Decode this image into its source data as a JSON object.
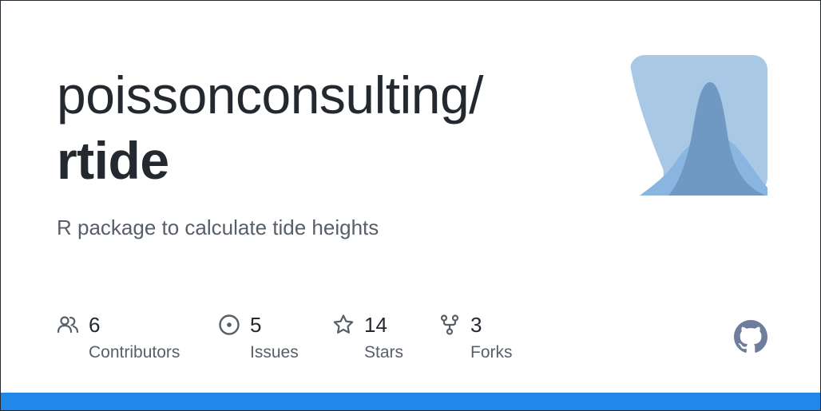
{
  "repo": {
    "owner": "poissonconsulting/",
    "name": "rtide",
    "description": "R package to calculate tide heights"
  },
  "stats": [
    {
      "icon": "people-icon",
      "count": "6",
      "label": "Contributors"
    },
    {
      "icon": "issue-icon",
      "count": "5",
      "label": "Issues"
    },
    {
      "icon": "star-icon",
      "count": "14",
      "label": "Stars"
    },
    {
      "icon": "fork-icon",
      "count": "3",
      "label": "Forks"
    }
  ],
  "colors": {
    "text": "#24292f",
    "muted": "#57606a",
    "icon": "#57606a",
    "accent_bar": "#2188ea",
    "logo_light": "#a9c8e6",
    "logo_mid": "#8ab5e0",
    "logo_dark": "#6f98c2",
    "github_mark": "#6e7d9a"
  }
}
